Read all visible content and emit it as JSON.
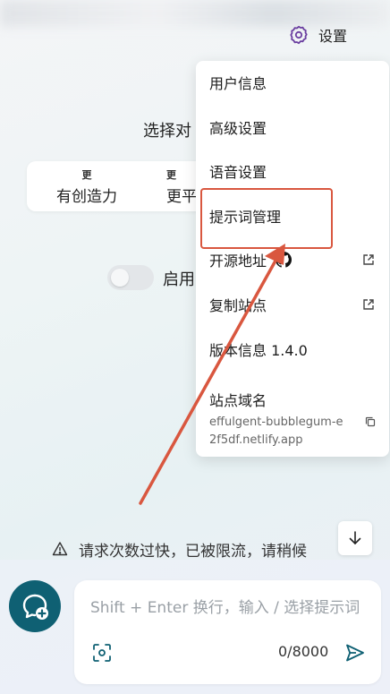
{
  "header": {
    "settings_label": "设置",
    "settings_icon": "gear-icon"
  },
  "main": {
    "select_title": "选择对",
    "modes": [
      {
        "small": "更",
        "label": "有创造力"
      },
      {
        "small": "更",
        "label": "更平"
      }
    ],
    "toggle_label": "启用"
  },
  "menu": {
    "items": [
      {
        "label": "用户信息"
      },
      {
        "label": "高级设置"
      },
      {
        "label": "语音设置"
      },
      {
        "label": "提示词管理"
      },
      {
        "label": "开源地址",
        "icon": "github-icon",
        "trailing": "external-link-icon"
      },
      {
        "label": "复制站点",
        "trailing": "external-link-icon"
      },
      {
        "label": "版本信息 1.4.0"
      }
    ],
    "domain": {
      "title": "站点域名",
      "url": "effulgent-bubblegum-e2f5df.netlify.app",
      "icon": "copy-icon"
    }
  },
  "annotation": {
    "color": "#d9573f"
  },
  "notice": {
    "text": "请求次数过快，已被限流，请稍候",
    "icon": "warning-icon"
  },
  "composer": {
    "placeholder": "Shift + Enter 换行，输入 / 选择提示词",
    "counter": "0/8000",
    "new_chat_color": "#0f6073",
    "accent": "#0f6073"
  }
}
